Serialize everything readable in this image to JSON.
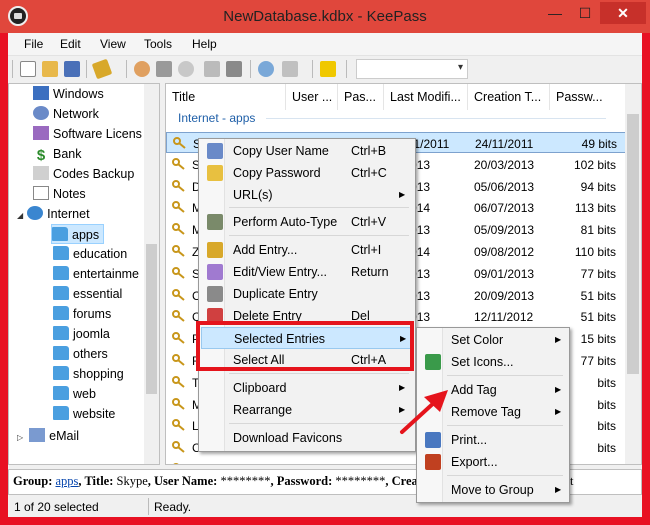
{
  "window": {
    "title": "NewDatabase.kdbx - KeePass",
    "min": "—",
    "max": "☐",
    "close": "✕"
  },
  "menubar": [
    "File",
    "Edit",
    "View",
    "Tools",
    "Help"
  ],
  "tree": {
    "items": [
      "Windows",
      "Network",
      "Software Licens",
      "Bank",
      "Codes Backup",
      "Notes",
      "Internet",
      "apps",
      "education",
      "entertainme",
      "essential",
      "forums",
      "joomla",
      "others",
      "shopping",
      "web",
      "website",
      "eMail"
    ],
    "selected": "apps"
  },
  "list": {
    "columns": [
      "Title",
      "User ...",
      "Pas...",
      "Last Modifi...",
      "Creation T...",
      "Passw..."
    ],
    "group": "Internet - apps",
    "rows": [
      [
        "Sk",
        "********",
        "********",
        "24/11/2011",
        "24/11/2011",
        "49 bits"
      ],
      [
        "S",
        "",
        "",
        "/3/2013",
        "20/03/2013",
        "102 bits"
      ],
      [
        "D",
        "",
        "",
        "/3/2013",
        "05/06/2013",
        "94 bits"
      ],
      [
        "M",
        "",
        "",
        "/2/2014",
        "06/07/2013",
        "113 bits"
      ],
      [
        "M",
        "",
        "",
        "/3/2013",
        "05/09/2013",
        "81 bits"
      ],
      [
        "Z",
        "",
        "",
        "/9/2014",
        "09/08/2012",
        "110 bits"
      ],
      [
        "S",
        "",
        "",
        "/3/2013",
        "09/01/2013",
        "77 bits"
      ],
      [
        "C",
        "",
        "",
        "/9/2013",
        "20/09/2013",
        "51 bits"
      ],
      [
        "C",
        "",
        "",
        "/3/2013",
        "12/11/2012",
        "51 bits"
      ],
      [
        "P",
        "",
        "",
        "",
        "",
        "15 bits"
      ],
      [
        "R",
        "",
        "",
        "",
        "",
        "77 bits"
      ],
      [
        "T",
        "",
        "",
        "",
        "",
        "bits"
      ],
      [
        "M",
        "",
        "",
        "",
        "",
        "bits"
      ],
      [
        "La",
        "",
        "",
        "",
        "",
        "bits"
      ],
      [
        "C",
        "",
        "",
        "",
        "",
        "bits"
      ],
      [
        "",
        "",
        "",
        "",
        "",
        "bits"
      ],
      [
        "If",
        "",
        "",
        "",
        "",
        "bits"
      ]
    ]
  },
  "context_menu": {
    "items": [
      {
        "label": "Copy User Name",
        "shortcut": "Ctrl+B"
      },
      {
        "label": "Copy Password",
        "shortcut": "Ctrl+C"
      },
      {
        "label": "URL(s)",
        "submenu": true
      },
      {
        "label": "Perform Auto-Type",
        "shortcut": "Ctrl+V"
      },
      {
        "label": "Add Entry...",
        "shortcut": "Ctrl+I"
      },
      {
        "label": "Edit/View Entry...",
        "shortcut": "Return"
      },
      {
        "label": "Duplicate Entry"
      },
      {
        "label": "Delete Entry",
        "shortcut": "Del"
      },
      {
        "label": "Selected Entries",
        "submenu": true
      },
      {
        "label": "Select All",
        "shortcut": "Ctrl+A"
      },
      {
        "label": "Clipboard",
        "submenu": true
      },
      {
        "label": "Rearrange",
        "submenu": true
      },
      {
        "label": "Download Favicons"
      }
    ]
  },
  "submenu": {
    "items": [
      {
        "label": "Set Color",
        "submenu": true
      },
      {
        "label": "Set Icons..."
      },
      {
        "label": "Add Tag",
        "submenu": true
      },
      {
        "label": "Remove Tag",
        "submenu": true
      },
      {
        "label": "Print..."
      },
      {
        "label": "Export..."
      },
      {
        "label": "Move to Group",
        "submenu": true
      }
    ]
  },
  "detail": {
    "group_label": "Group:",
    "group_value": "apps",
    "title_label": ", Title:",
    "title_value": "Skype",
    "user_label": ", User Name:",
    "user_value": "********",
    "pass_label": ", Password:",
    "pass_value": "********",
    "creation_label": ", Creation T",
    "tail": "t"
  },
  "status": {
    "count": "1 of 20 selected",
    "state": "Ready."
  },
  "colors": {
    "titlebar": "#e0473c",
    "highlight": "#cce8ff",
    "annotation": "#e5141c"
  }
}
